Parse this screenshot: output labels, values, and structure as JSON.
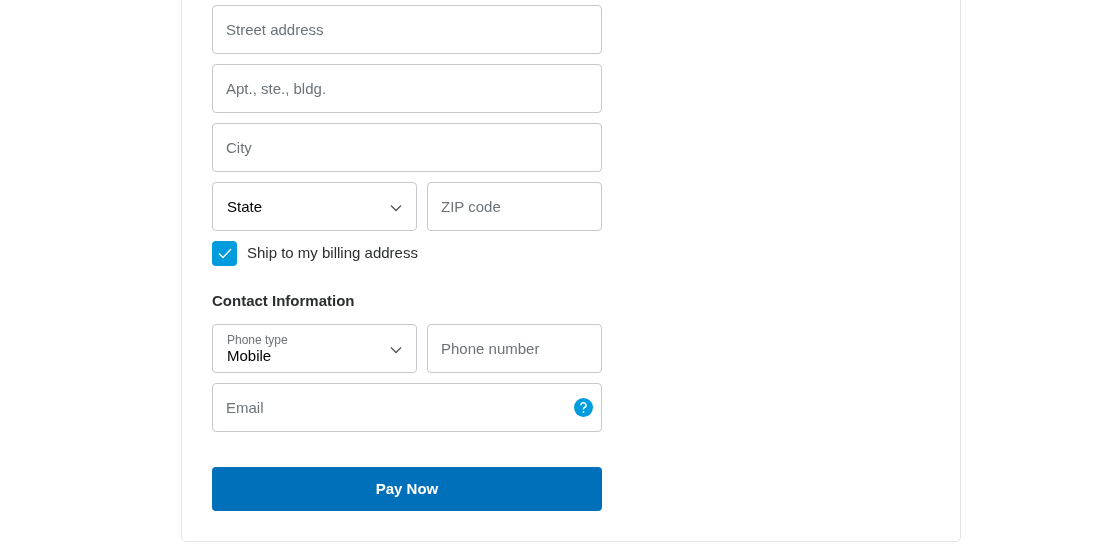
{
  "address_rows": [
    [
      {
        "kind": "input",
        "placeholder": "Street address"
      }
    ],
    [
      {
        "kind": "input",
        "placeholder": "Apt., ste., bldg."
      }
    ],
    [
      {
        "kind": "input",
        "placeholder": "City"
      }
    ],
    [
      {
        "kind": "select",
        "value": "State"
      },
      {
        "kind": "input",
        "placeholder": "ZIP code"
      }
    ]
  ],
  "ship_to_billing": {
    "label": "Ship to my billing address",
    "checked": true
  },
  "contact": {
    "heading": "Contact Information",
    "rows": [
      [
        {
          "kind": "select",
          "label": "Phone type",
          "value": "Mobile"
        },
        {
          "kind": "input",
          "placeholder": "Phone number"
        }
      ],
      [
        {
          "kind": "input",
          "placeholder": "Email",
          "help": true
        }
      ]
    ]
  },
  "pay_button": "Pay Now"
}
